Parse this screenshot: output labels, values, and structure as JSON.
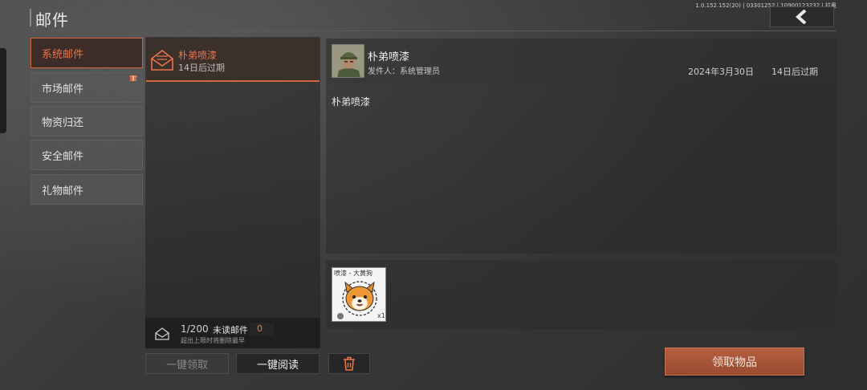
{
  "header": {
    "title": "邮件",
    "version": "1.0.152.152(20) | 03301252 | 10900123232 | 拉奥",
    "back_icon": "chevron-left-icon"
  },
  "categories": [
    {
      "label": "系统邮件",
      "active": true
    },
    {
      "label": "市场邮件",
      "badge": "gift-icon"
    },
    {
      "label": "物资归还"
    },
    {
      "label": "安全邮件"
    },
    {
      "label": "礼物邮件"
    }
  ],
  "mail_list": {
    "items": [
      {
        "title": "朴弟喷漆",
        "expire": "14日后过期",
        "icon": "open-envelope-icon"
      }
    ],
    "count": "1/200",
    "unread_label": "未读邮件",
    "unread_count": "0",
    "limit_note": "超出上限时将删除最早"
  },
  "actions": {
    "claim_all": "一键领取",
    "read_all": "一键阅读",
    "delete_icon": "trash-icon"
  },
  "detail": {
    "title": "朴弟喷漆",
    "sender": "发件人：系统管理员",
    "date": "2024年3月30日",
    "expire": "14日后过期",
    "body": "朴弟喷漆",
    "attachment": {
      "label": "喷漆 - 大黄狗",
      "qty": "x1",
      "icon": "dog-spray-icon"
    },
    "claim_button": "领取物品"
  },
  "colors": {
    "accent": "#e9744b",
    "button": "#a9553a"
  }
}
